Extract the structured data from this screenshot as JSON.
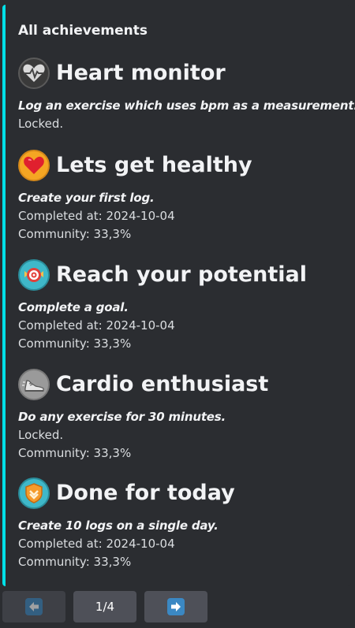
{
  "embed": {
    "accent_color": "#00e0e8",
    "title": "All achievements"
  },
  "achievements": [
    {
      "name": "Heart monitor",
      "icon": "heart-monitor-icon",
      "description": "Log an exercise which uses bpm as a measurement.",
      "status": "Locked.",
      "community": ""
    },
    {
      "name": "Lets get healthy",
      "icon": "heart-icon",
      "description": "Create your first log.",
      "status": "Completed at: 2024-10-04",
      "community": "Community: 33,3%"
    },
    {
      "name": "Reach your potential",
      "icon": "target-icon",
      "description": "Complete a goal.",
      "status": "Completed at: 2024-10-04",
      "community": "Community: 33,3%"
    },
    {
      "name": "Cardio enthusiast",
      "icon": "running-shoe-icon",
      "description": "Do any exercise for 30 minutes.",
      "status": "Locked.",
      "community": "Community: 33,3%"
    },
    {
      "name": "Done for today",
      "icon": "shield-icon",
      "description": "Create 10 logs on a single day.",
      "status": "Completed at: 2024-10-04",
      "community": "Community: 33,3%"
    }
  ],
  "pagination": {
    "prev_icon": "arrow-left-icon",
    "page_label": "1/4",
    "next_icon": "arrow-right-icon"
  }
}
